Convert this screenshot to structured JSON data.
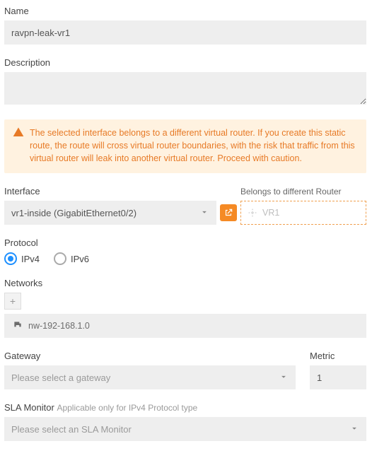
{
  "labels": {
    "name": "Name",
    "description": "Description",
    "interface": "Interface",
    "belongs_to": "Belongs to different Router",
    "protocol": "Protocol",
    "networks": "Networks",
    "gateway": "Gateway",
    "metric": "Metric",
    "sla_monitor": "SLA Monitor",
    "sla_hint": "Applicable only for IPv4 Protocol type"
  },
  "values": {
    "name": "ravpn-leak-vr1",
    "description": "",
    "interface_selected": "vr1-inside (GigabitEthernet0/2)",
    "router_name": "VR1",
    "gateway_placeholder": "Please select a gateway",
    "metric": "1",
    "sla_placeholder": "Please select an SLA Monitor"
  },
  "alert": {
    "text": "The selected interface belongs to a different virtual router. If you create this static route, the route will cross virtual router boundaries, with the risk that traffic from this virtual router will leak into another virtual router. Proceed with caution."
  },
  "protocol": {
    "ipv4": "IPv4",
    "ipv6": "IPv6",
    "selected": "ipv4"
  },
  "networks_list": [
    {
      "name": "nw-192-168.1.0"
    }
  ]
}
